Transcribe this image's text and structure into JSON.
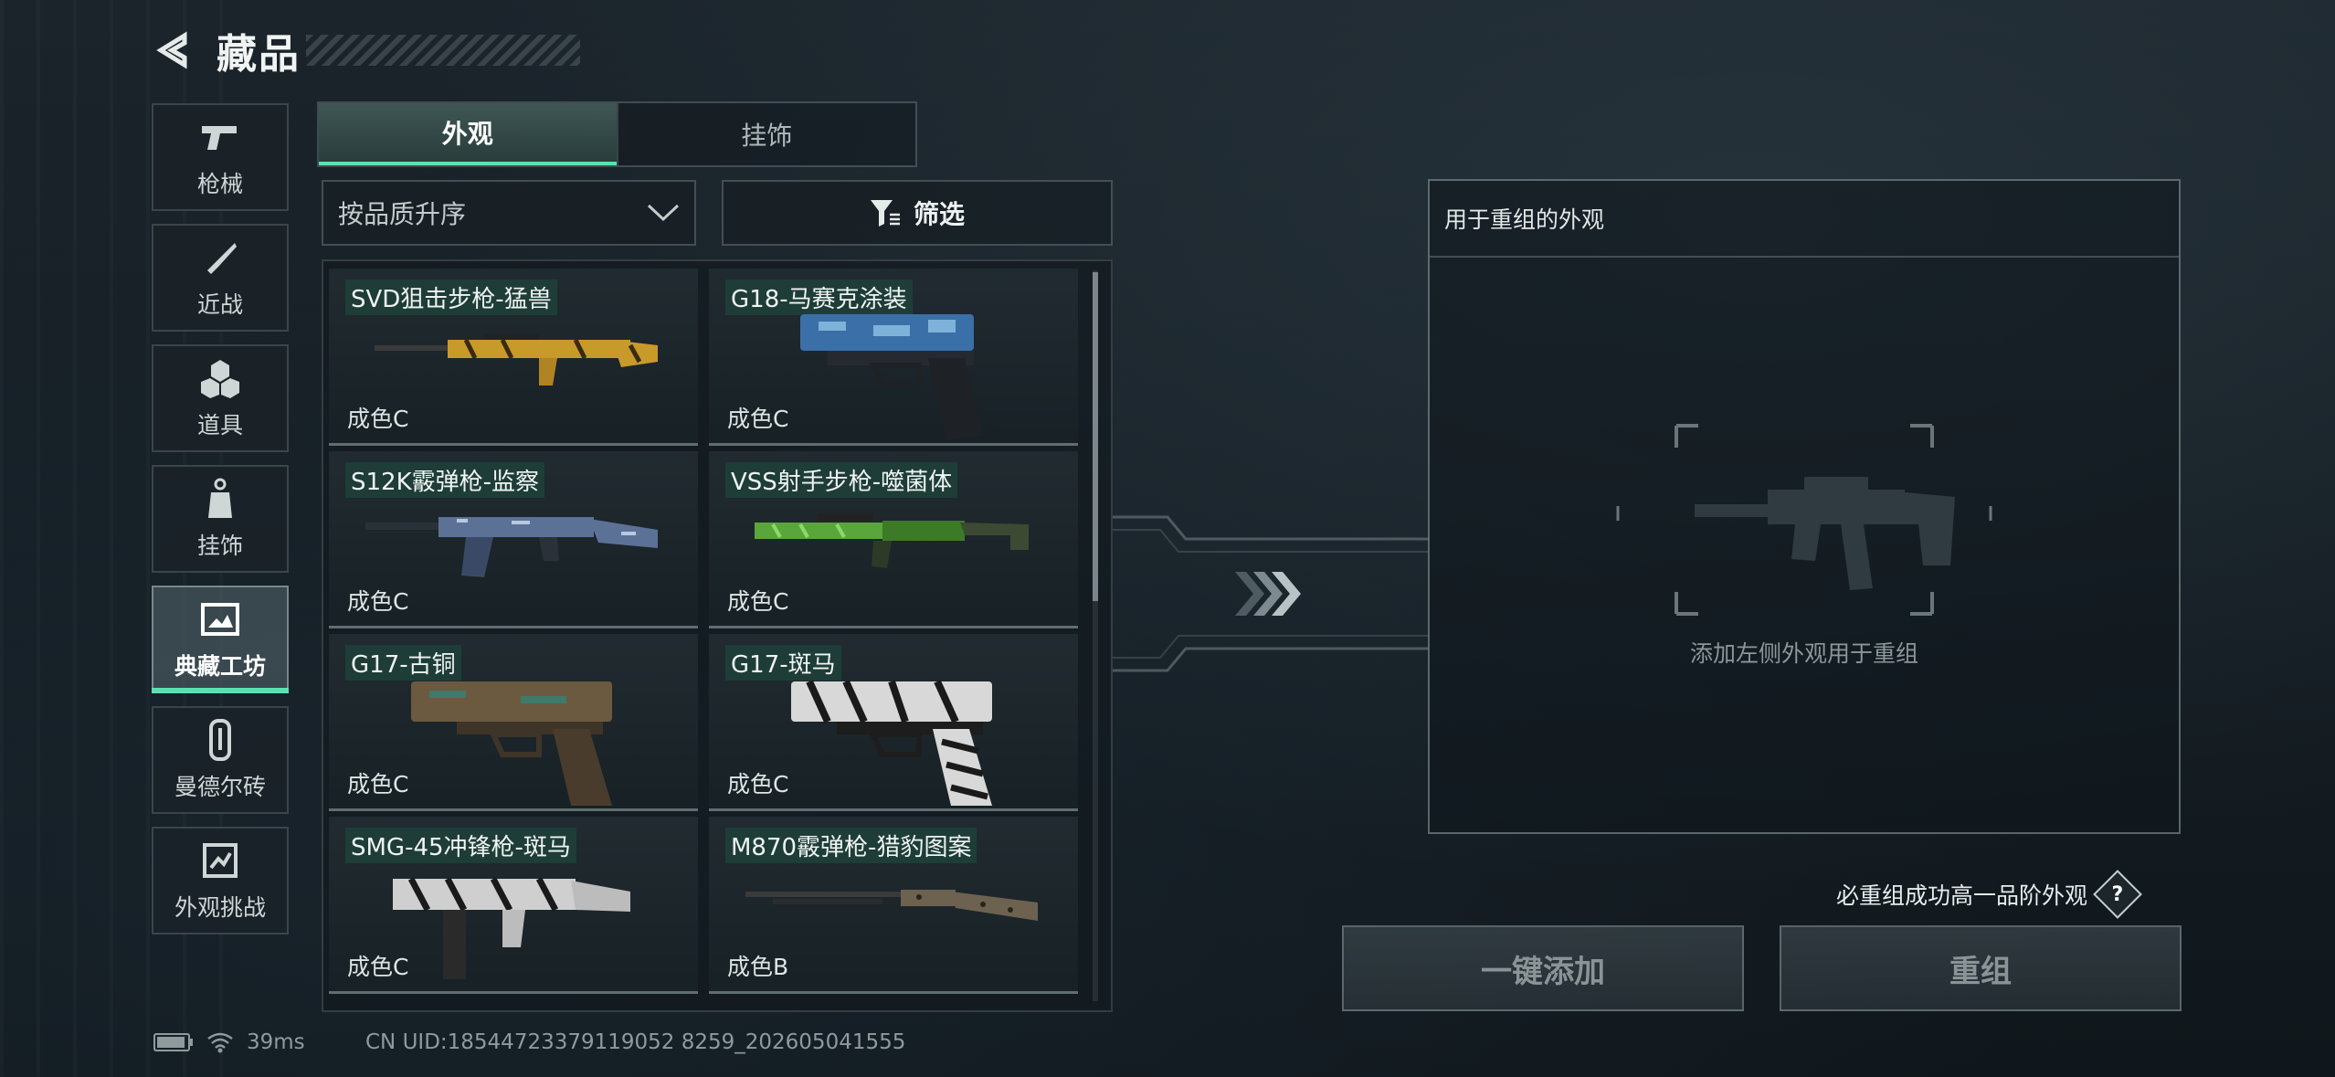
{
  "header": {
    "title": "藏品"
  },
  "categories": [
    {
      "label": "枪械",
      "icon": "pistol-icon"
    },
    {
      "label": "近战",
      "icon": "knife-icon"
    },
    {
      "label": "道具",
      "icon": "cubes-icon"
    },
    {
      "label": "挂饰",
      "icon": "charm-icon"
    },
    {
      "label": "典藏工坊",
      "icon": "workshop-icon",
      "active": true
    },
    {
      "label": "曼德尔砖",
      "icon": "mandel-brick-icon"
    },
    {
      "label": "外观挑战",
      "icon": "challenge-icon"
    }
  ],
  "tabs": [
    {
      "label": "外观",
      "active": true
    },
    {
      "label": "挂饰",
      "active": false
    }
  ],
  "sort": {
    "value": "按品质升序"
  },
  "filter": {
    "label": "筛选"
  },
  "items": [
    {
      "name": "SVD狙击步枪-猛兽",
      "grade": "成色C",
      "color": "#c79a2a"
    },
    {
      "name": "G18-马赛克涂装",
      "grade": "成色C",
      "color": "#3b6fa8"
    },
    {
      "name": "S12K霰弹枪-监察",
      "grade": "成色C",
      "color": "#5c7196"
    },
    {
      "name": "VSS射手步枪-噬菌体",
      "grade": "成色C",
      "color": "#5aa63a"
    },
    {
      "name": "G17-古铜",
      "grade": "成色C",
      "color": "#6b5a40"
    },
    {
      "name": "G17-斑马",
      "grade": "成色C",
      "color": "#d8d8d8"
    },
    {
      "name": "SMG-45冲锋枪-斑马",
      "grade": "成色C",
      "color": "#cfcfcf"
    },
    {
      "name": "M870霰弹枪-猎豹图案",
      "grade": "成色B",
      "color": "#6d6250"
    }
  ],
  "reassembly": {
    "header": "用于重组的外观",
    "hint": "添加左侧外观用于重组",
    "guarantee": "必重组成功高一品阶外观"
  },
  "buttons": {
    "add_all": "一键添加",
    "reassemble": "重组"
  },
  "status": {
    "ping": "39ms",
    "uid": "CN UID:18544723379119052 8259_202605041555"
  },
  "colors": {
    "accent": "#5de0b0"
  }
}
